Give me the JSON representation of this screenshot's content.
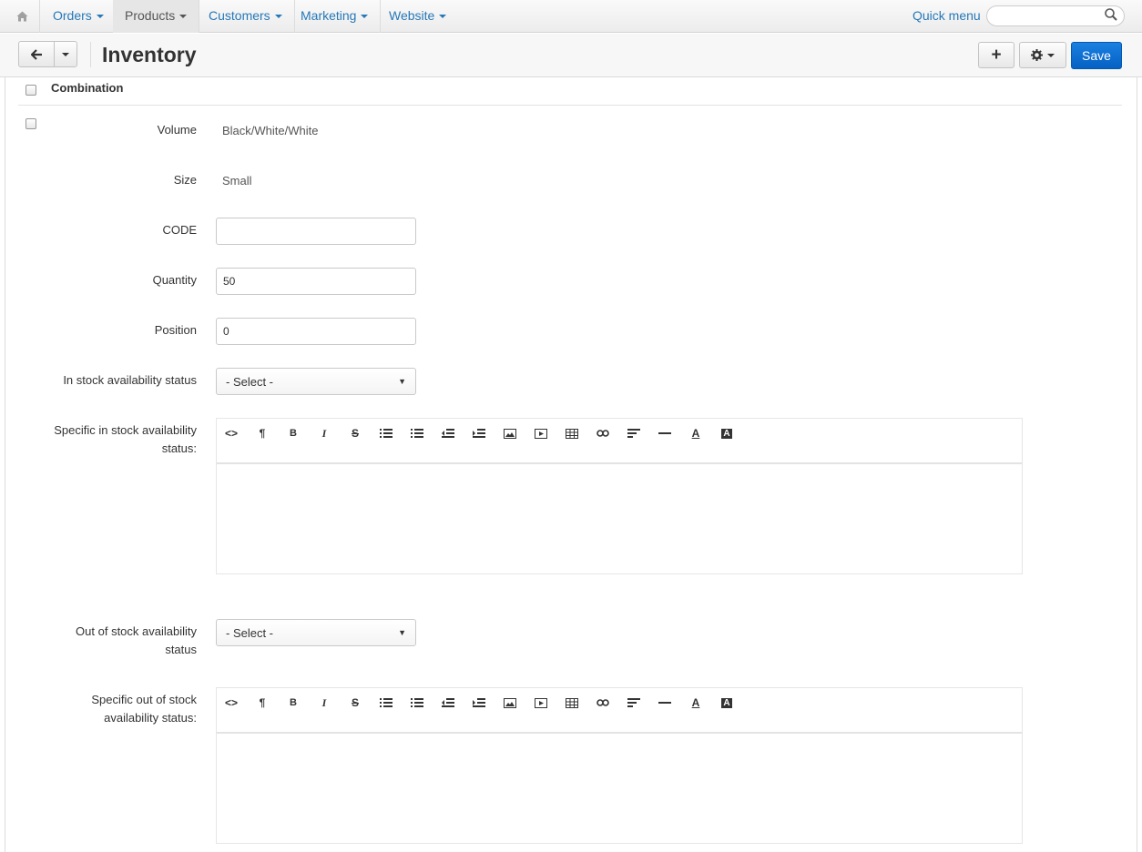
{
  "nav": {
    "items": [
      {
        "label": "Orders"
      },
      {
        "label": "Products"
      },
      {
        "label": "Customers"
      },
      {
        "label": "Marketing"
      },
      {
        "label": "Website"
      }
    ],
    "quick_menu": "Quick menu",
    "search_value": ""
  },
  "header": {
    "title": "Inventory",
    "add_label": "+",
    "save_label": "Save"
  },
  "table": {
    "column_header": "Combination"
  },
  "fields": {
    "volume_label": "Volume",
    "volume_value": "Black/White/White",
    "size_label": "Size",
    "size_value": "Small",
    "code_label": "CODE",
    "code_value": "",
    "quantity_label": "Quantity",
    "quantity_value": "50",
    "position_label": "Position",
    "position_value": "0",
    "in_stock_label": "In stock availability status",
    "in_stock_selected": "- Select -",
    "specific_in_stock_label_1": "Specific in stock availability",
    "specific_in_stock_label_2": "status:",
    "out_stock_label_1": "Out of stock availability",
    "out_stock_label_2": "status",
    "out_stock_selected": "- Select -",
    "specific_out_stock_label_1": "Specific out of stock",
    "specific_out_stock_label_2": "availability status:"
  },
  "toolbar_icons": [
    "html-icon",
    "paragraph-icon",
    "bold-icon",
    "italic-icon",
    "strikethrough-icon",
    "unordered-list-icon",
    "ordered-list-icon",
    "outdent-icon",
    "indent-icon",
    "image-icon",
    "video-icon",
    "table-icon",
    "link-icon",
    "align-icon",
    "horizontal-rule-icon",
    "font-color-icon",
    "background-color-icon"
  ],
  "colors": {
    "link": "#2678b8",
    "save": "#0661c5"
  }
}
